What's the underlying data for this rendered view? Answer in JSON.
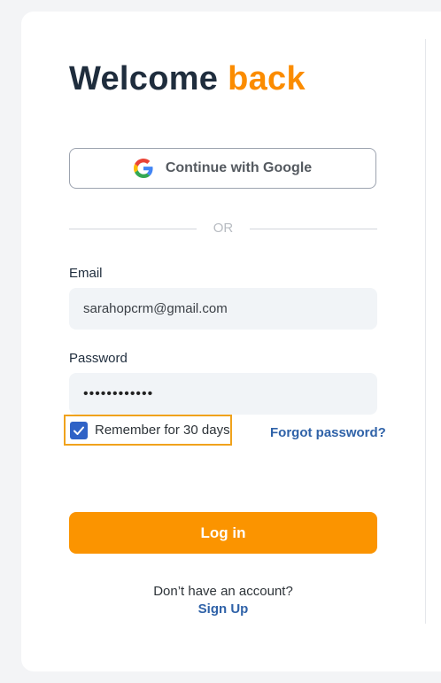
{
  "heading": {
    "part1": "Welcome",
    "part2": "back"
  },
  "google_button": {
    "label": "Continue with Google",
    "icon": "google-logo"
  },
  "separator": {
    "text": "OR"
  },
  "email": {
    "label": "Email",
    "value": "sarahopcrm@gmail.com"
  },
  "password": {
    "label": "Password",
    "value": "••••••••••••"
  },
  "remember": {
    "label": "Remember for 30 days",
    "checked": true
  },
  "forgot_link": "Forgot password?",
  "login_button": "Log in",
  "signup": {
    "prompt": "Don’t have an account?",
    "link": "Sign Up"
  },
  "colors": {
    "accent": "#fb9400",
    "link": "#2f62a8",
    "checkbox": "#2f62c6",
    "highlight_border": "#f0a21c"
  }
}
